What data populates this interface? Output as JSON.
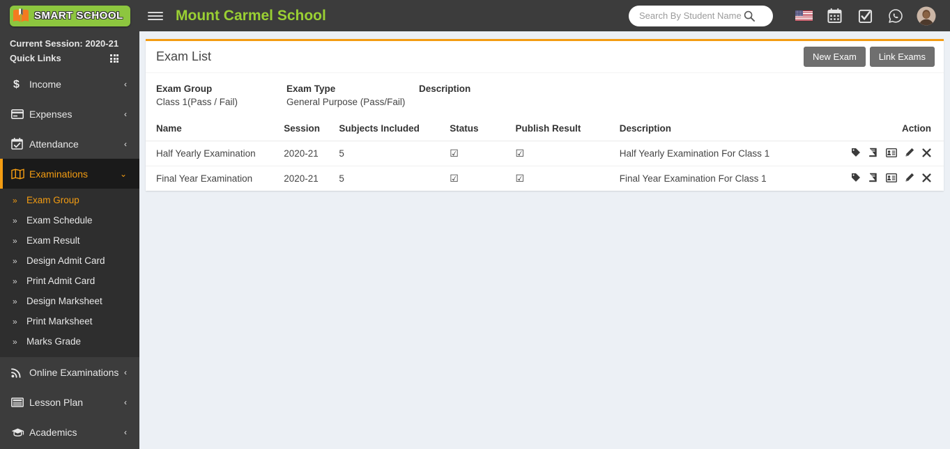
{
  "header": {
    "logo_text": "SMART SCHOOL",
    "logo_icon": "open-book-icon",
    "menu_toggle_icon": "hamburger-icon",
    "school_title": "Mount Carmel School",
    "search": {
      "placeholder": "Search By Student Name",
      "value": "",
      "icon": "search-icon"
    },
    "icons": [
      {
        "name": "flag-icon",
        "label": "United States"
      },
      {
        "name": "calendar-icon",
        "label": "Calendar"
      },
      {
        "name": "checkbox-icon",
        "label": "Tasks"
      },
      {
        "name": "whatsapp-icon",
        "label": "WhatsApp"
      },
      {
        "name": "avatar",
        "label": "Profile"
      }
    ]
  },
  "sidebar": {
    "session_label": "Current Session: 2020-21",
    "quick_links_label": "Quick Links",
    "quick_links_icon": "grid-icon",
    "items": [
      {
        "label": "Income",
        "icon": "dollar-icon",
        "arrow": "‹",
        "active": false
      },
      {
        "label": "Expenses",
        "icon": "credit-card-icon",
        "arrow": "‹",
        "active": false
      },
      {
        "label": "Attendance",
        "icon": "calendar-check-icon",
        "arrow": "‹",
        "active": false
      },
      {
        "label": "Examinations",
        "icon": "book-open-icon",
        "arrow": "‹",
        "active": true
      }
    ],
    "submenu": [
      {
        "label": "Exam Group",
        "active": true
      },
      {
        "label": "Exam Schedule",
        "active": false
      },
      {
        "label": "Exam Result",
        "active": false
      },
      {
        "label": "Design Admit Card",
        "active": false
      },
      {
        "label": "Print Admit Card",
        "active": false
      },
      {
        "label": "Design Marksheet",
        "active": false
      },
      {
        "label": "Print Marksheet",
        "active": false
      },
      {
        "label": "Marks Grade",
        "active": false
      }
    ],
    "items_after": [
      {
        "label": "Online Examinations",
        "icon": "rss-icon",
        "arrow": "‹",
        "active": false
      },
      {
        "label": "Lesson Plan",
        "icon": "newspaper-icon",
        "arrow": "‹",
        "active": false
      },
      {
        "label": "Academics",
        "icon": "graduation-cap-icon",
        "arrow": "‹",
        "active": false
      }
    ]
  },
  "main": {
    "card_title": "Exam List",
    "buttons": {
      "new_exam": "New Exam",
      "link_exams": "Link Exams"
    },
    "meta": {
      "exam_group_label": "Exam Group",
      "exam_group_value": "Class 1(Pass / Fail)",
      "exam_type_label": "Exam Type",
      "exam_type_value": "General Purpose (Pass/Fail)",
      "description_label": "Description",
      "description_value": ""
    },
    "table": {
      "columns": [
        "Name",
        "Session",
        "Subjects Included",
        "Status",
        "Publish Result",
        "Description",
        "Action"
      ],
      "rows": [
        {
          "name": "Half Yearly Examination",
          "session": "2020-21",
          "subjects_included": "5",
          "status": "☑",
          "publish_result": "☑",
          "description": "Half Yearly Examination For Class 1"
        },
        {
          "name": "Final Year Examination",
          "session": "2020-21",
          "subjects_included": "5",
          "status": "☑",
          "publish_result": "☑",
          "description": "Final Year Examination For Class 1"
        }
      ],
      "row_actions": [
        {
          "name": "tag-icon",
          "label": "Assign Marks"
        },
        {
          "name": "book-icon",
          "label": "Exam Subjects"
        },
        {
          "name": "id-card-icon",
          "label": "Admit Card"
        },
        {
          "name": "pencil-icon",
          "label": "Edit"
        },
        {
          "name": "times-icon",
          "label": "Delete"
        }
      ]
    }
  },
  "colors": {
    "accent_orange": "#f39c12",
    "brand_green": "#8dc63f",
    "title_green": "#9ad033",
    "sidebar_bg": "#3c3c3c",
    "page_bg": "#ecf0f5",
    "button_gray": "#6f6f6f"
  }
}
